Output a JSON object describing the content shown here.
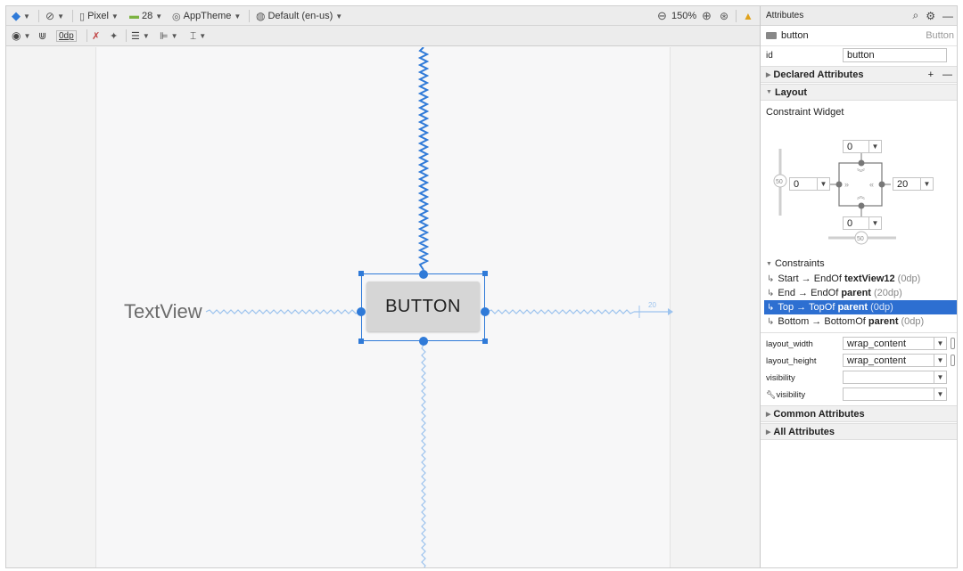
{
  "toolbar": {
    "device": "Pixel",
    "api": "28",
    "theme": "AppTheme",
    "locale": "Default (en-us)",
    "zoom": "150%",
    "margin": "0dp"
  },
  "canvas": {
    "textview_label": "TextView",
    "button_label": "BUTTON",
    "end_margin_hint": "20"
  },
  "panel": {
    "title": "Attributes",
    "widget_name": "button",
    "widget_type": "Button",
    "id_label": "id",
    "id_value": "button",
    "declared": "Declared Attributes",
    "layout": "Layout",
    "constraint_widget": "Constraint Widget",
    "widget": {
      "top": "0",
      "left": "0",
      "right": "20",
      "bottom": "0",
      "bias_v": "50",
      "bias_h": "50"
    },
    "constraints_title": "Constraints",
    "constraints": [
      {
        "pre": "Start → EndOf ",
        "target": "textView12",
        "margin": "(0dp)"
      },
      {
        "pre": "End → EndOf ",
        "target": "parent",
        "margin": "(20dp)"
      },
      {
        "pre": "Top → TopOf ",
        "target": "parent",
        "margin": "(0dp)"
      },
      {
        "pre": "Bottom → BottomOf ",
        "target": "parent",
        "margin": "(0dp)"
      }
    ],
    "props": [
      {
        "label": "layout_width",
        "value": "wrap_content"
      },
      {
        "label": "layout_height",
        "value": "wrap_content"
      },
      {
        "label": "visibility",
        "value": ""
      },
      {
        "label": "visibility",
        "value": ""
      }
    ],
    "common": "Common Attributes",
    "all": "All Attributes"
  },
  "colors": {
    "accent": "#2f7ad8",
    "selection": "#2d6fd1",
    "warning": "#e0a21b"
  }
}
